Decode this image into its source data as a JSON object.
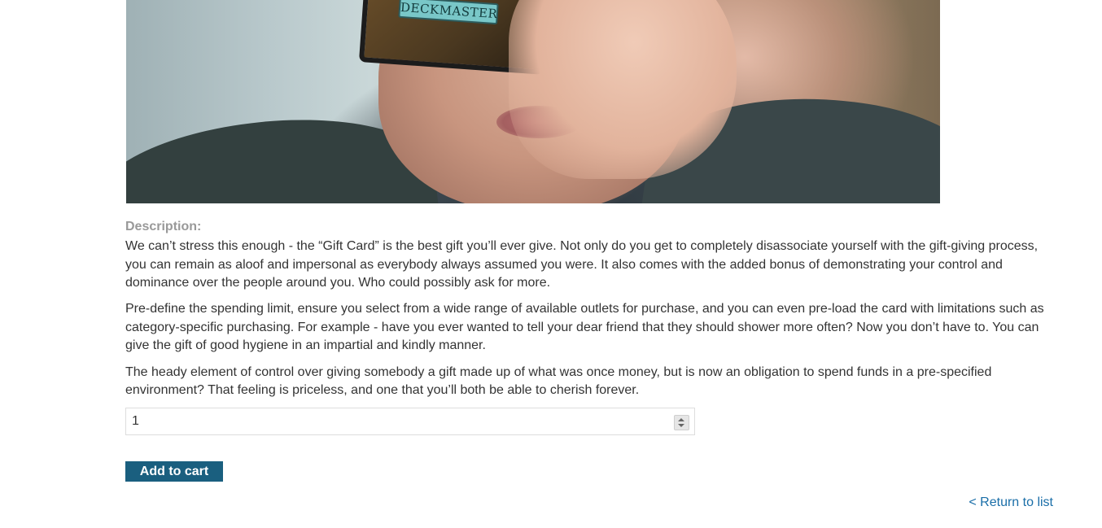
{
  "product": {
    "image": {
      "alt": "Person holding a card over their face",
      "card_text": "DECKMASTER"
    },
    "description_label": "Description:",
    "description_paragraphs": [
      "We can’t stress this enough - the “Gift Card” is the best gift you’ll ever give. Not only do you get to completely disassociate yourself with the gift-giving process, you can remain as aloof and impersonal as everybody always assumed you were. It also comes with the added bonus of demonstrating your control and dominance over the people around you. Who could possibly ask for more.",
      "Pre-define the spending limit, ensure you select from a wide range of available outlets for purchase, and you can even pre-load the card with limitations such as category-specific purchasing. For example - have you ever wanted to tell your dear friend that they should shower more often? Now you don’t have to. You can give the gift of good hygiene in an impartial and kindly manner.",
      "The heady element of control over giving somebody a gift made up of what was once money, but is now an obligation to spend funds in a pre-specified environment? That feeling is priceless, and one that you’ll both be able to cherish forever."
    ]
  },
  "quantity": {
    "value": "1"
  },
  "actions": {
    "add_to_cart_label": "Add to cart",
    "return_label": "< Return to list"
  },
  "colors": {
    "button_bg": "#1a5f7f",
    "link": "#1a6ea8",
    "label_gray": "#999999"
  },
  "icons": {
    "spinner": "number-spinner-icon"
  }
}
